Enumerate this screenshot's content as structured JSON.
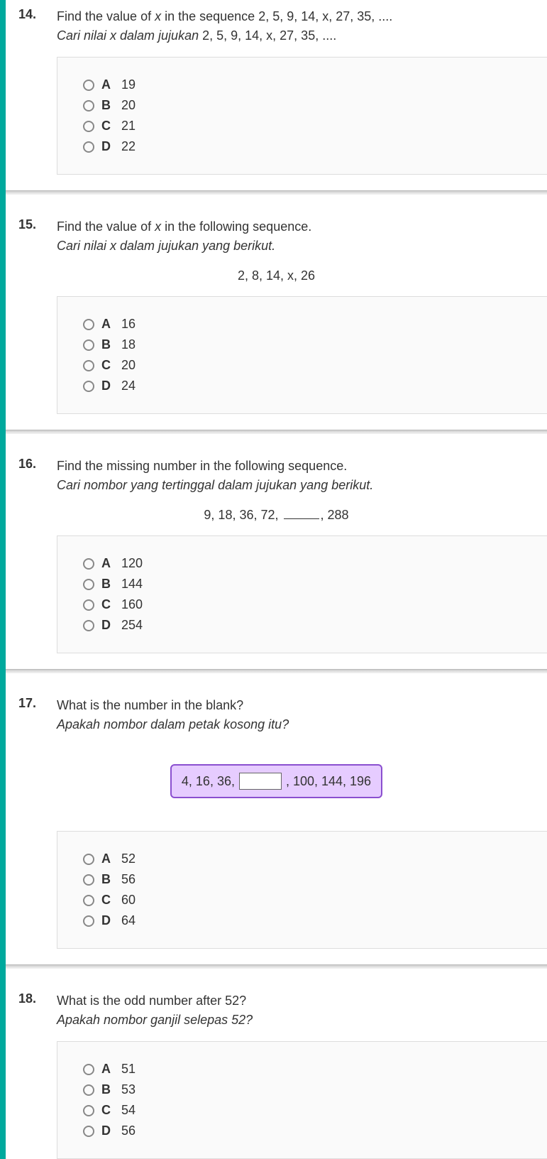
{
  "questions": [
    {
      "num": "14.",
      "en_pre": "Find the value of ",
      "en_var": "x",
      "en_post": " in the sequence 2, 5, 9, 14, x, 27, 35, ....",
      "ms_pre": "Cari nilai x dalam jujukan ",
      "ms_post": "2, 5, 9, 14, x, 27, 35, ....",
      "answers": [
        {
          "letter": "A",
          "text": "19"
        },
        {
          "letter": "B",
          "text": "20"
        },
        {
          "letter": "C",
          "text": "21"
        },
        {
          "letter": "D",
          "text": "22"
        }
      ]
    },
    {
      "num": "15.",
      "en_pre": "Find the value of ",
      "en_var": "x",
      "en_post": " in the following sequence.",
      "ms": "Cari nilai x dalam jujukan yang berikut.",
      "sequence": "2, 8, 14, x, 26",
      "answers": [
        {
          "letter": "A",
          "text": "16"
        },
        {
          "letter": "B",
          "text": "18"
        },
        {
          "letter": "C",
          "text": "20"
        },
        {
          "letter": "D",
          "text": "24"
        }
      ]
    },
    {
      "num": "16.",
      "en": "Find the missing number in the following sequence.",
      "ms": "Cari nombor yang tertinggal dalam jujukan yang berikut.",
      "seq_pre": "9, 18, 36, 72, ",
      "seq_post": ", 288",
      "answers": [
        {
          "letter": "A",
          "text": "120"
        },
        {
          "letter": "B",
          "text": "144"
        },
        {
          "letter": "C",
          "text": "160"
        },
        {
          "letter": "D",
          "text": "254"
        }
      ]
    },
    {
      "num": "17.",
      "en": "What is the number in the blank?",
      "ms": "Apakah nombor dalam petak kosong itu?",
      "box_pre": "4, 16, 36,",
      "box_post": ", 100, 144, 196",
      "answers": [
        {
          "letter": "A",
          "text": "52"
        },
        {
          "letter": "B",
          "text": "56"
        },
        {
          "letter": "C",
          "text": "60"
        },
        {
          "letter": "D",
          "text": "64"
        }
      ]
    },
    {
      "num": "18.",
      "en": "What is the odd number after 52?",
      "ms": "Apakah nombor ganjil selepas 52?",
      "answers": [
        {
          "letter": "A",
          "text": "51"
        },
        {
          "letter": "B",
          "text": "53"
        },
        {
          "letter": "C",
          "text": "54"
        },
        {
          "letter": "D",
          "text": "56"
        }
      ]
    }
  ]
}
